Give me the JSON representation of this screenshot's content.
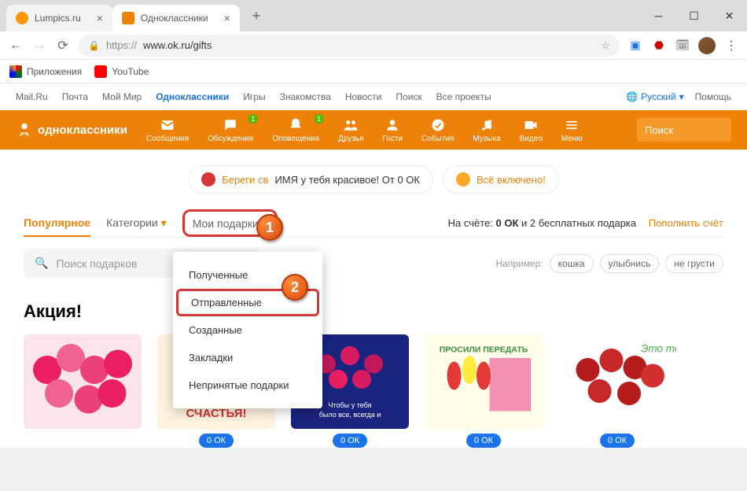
{
  "window": {
    "tab1": "Lumpics.ru",
    "tab2": "Одноклассники"
  },
  "browser": {
    "url_prefix": "https://",
    "url": "www.ok.ru/gifts"
  },
  "bookmarks": {
    "apps": "Приложения",
    "yt": "YouTube"
  },
  "topnav": {
    "items": [
      "Mail.Ru",
      "Почта",
      "Мой Мир",
      "Одноклассники",
      "Игры",
      "Знакомства",
      "Новости",
      "Поиск",
      "Все проекты"
    ],
    "lang": "Русский",
    "help": "Помощь"
  },
  "mainnav": {
    "logo": "одноклассники",
    "items": [
      {
        "label": "Сообщения"
      },
      {
        "label": "Обсуждения",
        "badge": "1"
      },
      {
        "label": "Оповещения",
        "badge": "1"
      },
      {
        "label": "Друзья"
      },
      {
        "label": "Гости"
      },
      {
        "label": "События"
      },
      {
        "label": "Музыка"
      },
      {
        "label": "Видео"
      },
      {
        "label": "Меню"
      }
    ],
    "search": "Поиск"
  },
  "promo": {
    "btn1_a": "Береги св",
    "btn1_b": "ИМЯ у тебя красивое! От 0 ОК",
    "btn2": "Всё включено!"
  },
  "tabs": {
    "popular": "Популярное",
    "categories": "Категории",
    "mygifts": "Мои подарки",
    "account_label": "На счёте: ",
    "account_bold": "0 ОК",
    "account_rest": " и 2 бесплатных подарка",
    "topup": "Пополнить счёт"
  },
  "dropdown": {
    "items": [
      "Полученные",
      "Отправленные",
      "Созданные",
      "Закладки",
      "Непринятые подарки"
    ]
  },
  "search_gifts": {
    "placeholder": "Поиск подарков",
    "examples_label": "Например:",
    "tags": [
      "кошка",
      "улыбнись",
      "не грусти"
    ]
  },
  "section": {
    "title": "Акция!"
  },
  "gifts": {
    "price": "0 ОК"
  },
  "markers": {
    "one": "1",
    "two": "2"
  }
}
